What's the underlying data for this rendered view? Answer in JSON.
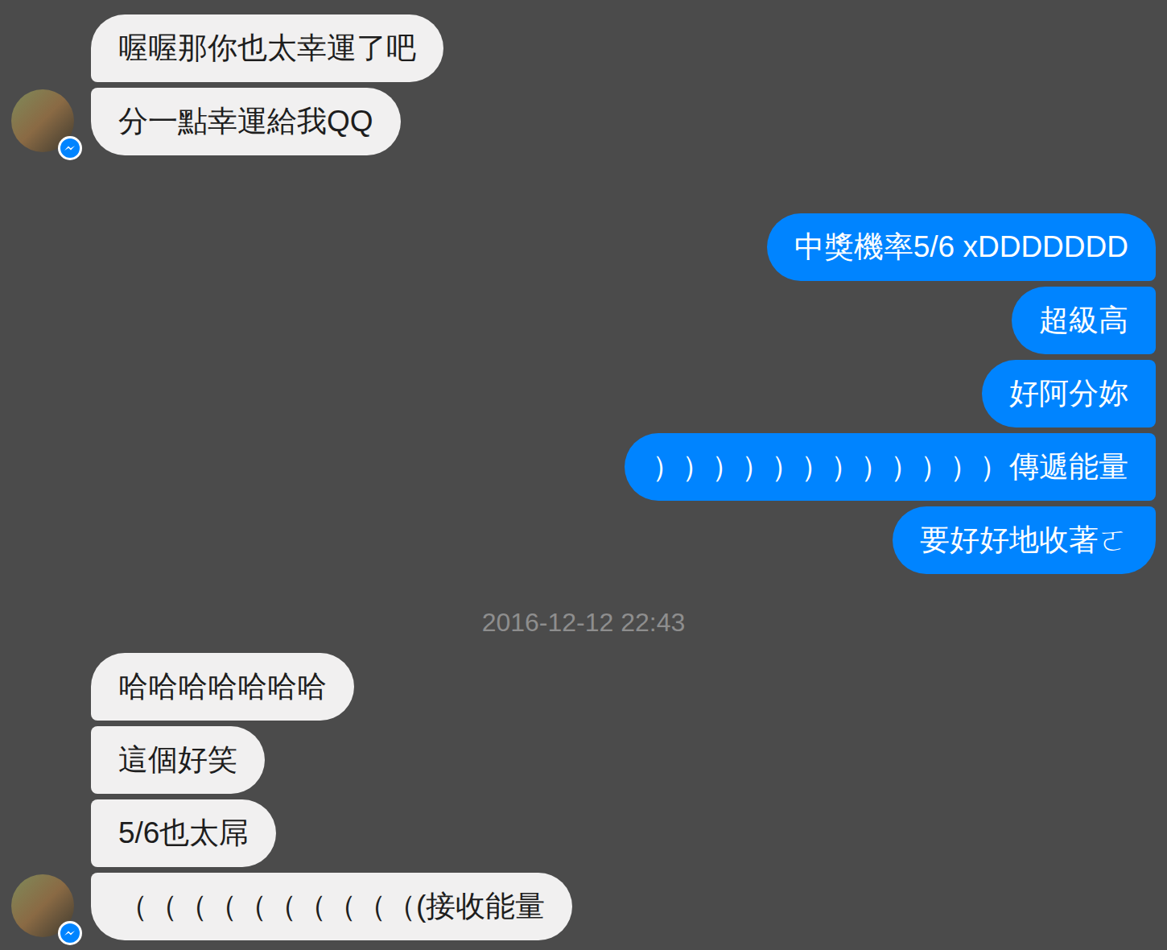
{
  "thread": [
    {
      "kind": "group",
      "from": "other",
      "messages": [
        "喔喔那你也太幸運了吧",
        "分一點幸運給我QQ"
      ]
    },
    {
      "kind": "group",
      "from": "me",
      "messages": [
        "中獎機率5/6 xDDDDDDD",
        "超級高",
        "好阿分妳",
        "））））））））））））傳遞能量",
        "要好好地收著ㄛ"
      ]
    },
    {
      "kind": "timestamp",
      "text": "2016-12-12 22:43"
    },
    {
      "kind": "group",
      "from": "other",
      "messages": [
        "哈哈哈哈哈哈哈",
        "這個好笑",
        "5/6也太屌",
        "（（（（（（（（（（(接收能量"
      ]
    }
  ]
}
